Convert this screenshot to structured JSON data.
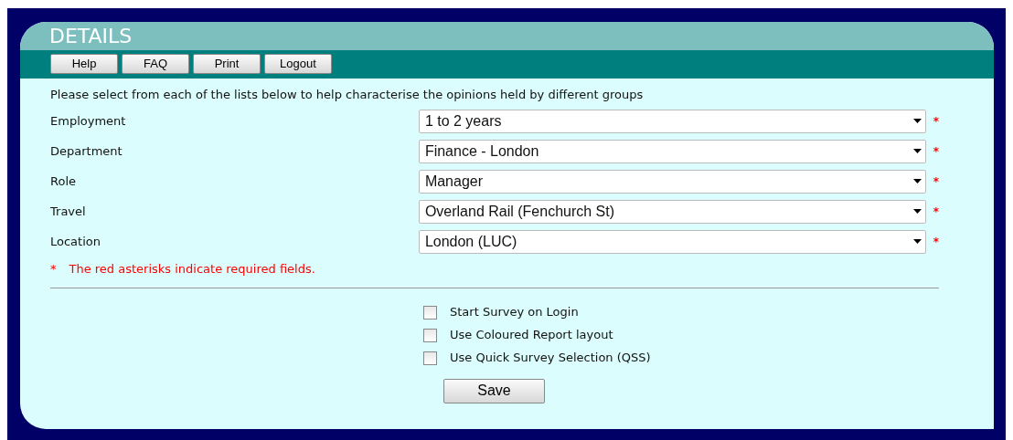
{
  "header": {
    "title": "DETAILS"
  },
  "toolbar": [
    "Help",
    "FAQ",
    "Print",
    "Logout"
  ],
  "intro": "Please select from each of the lists below to help characterise the opinions held by different groups",
  "fields": [
    {
      "label": "Employment",
      "value": "1 to 2 years",
      "required_mark": "*"
    },
    {
      "label": "Department",
      "value": "Finance - London",
      "required_mark": "*"
    },
    {
      "label": "Role",
      "value": "Manager",
      "required_mark": "*"
    },
    {
      "label": "Travel",
      "value": "Overland Rail (Fenchurch St)",
      "required_mark": "*"
    },
    {
      "label": "Location",
      "value": "London (LUC)",
      "required_mark": "*"
    }
  ],
  "legend": {
    "mark": "*",
    "text": "The red asterisks indicate required fields."
  },
  "options": [
    {
      "label": "Start Survey on Login",
      "checked": false
    },
    {
      "label": "Use Coloured Report layout",
      "checked": false
    },
    {
      "label": "Use Quick Survey Selection (QSS)",
      "checked": false
    }
  ],
  "save_button": "Save"
}
